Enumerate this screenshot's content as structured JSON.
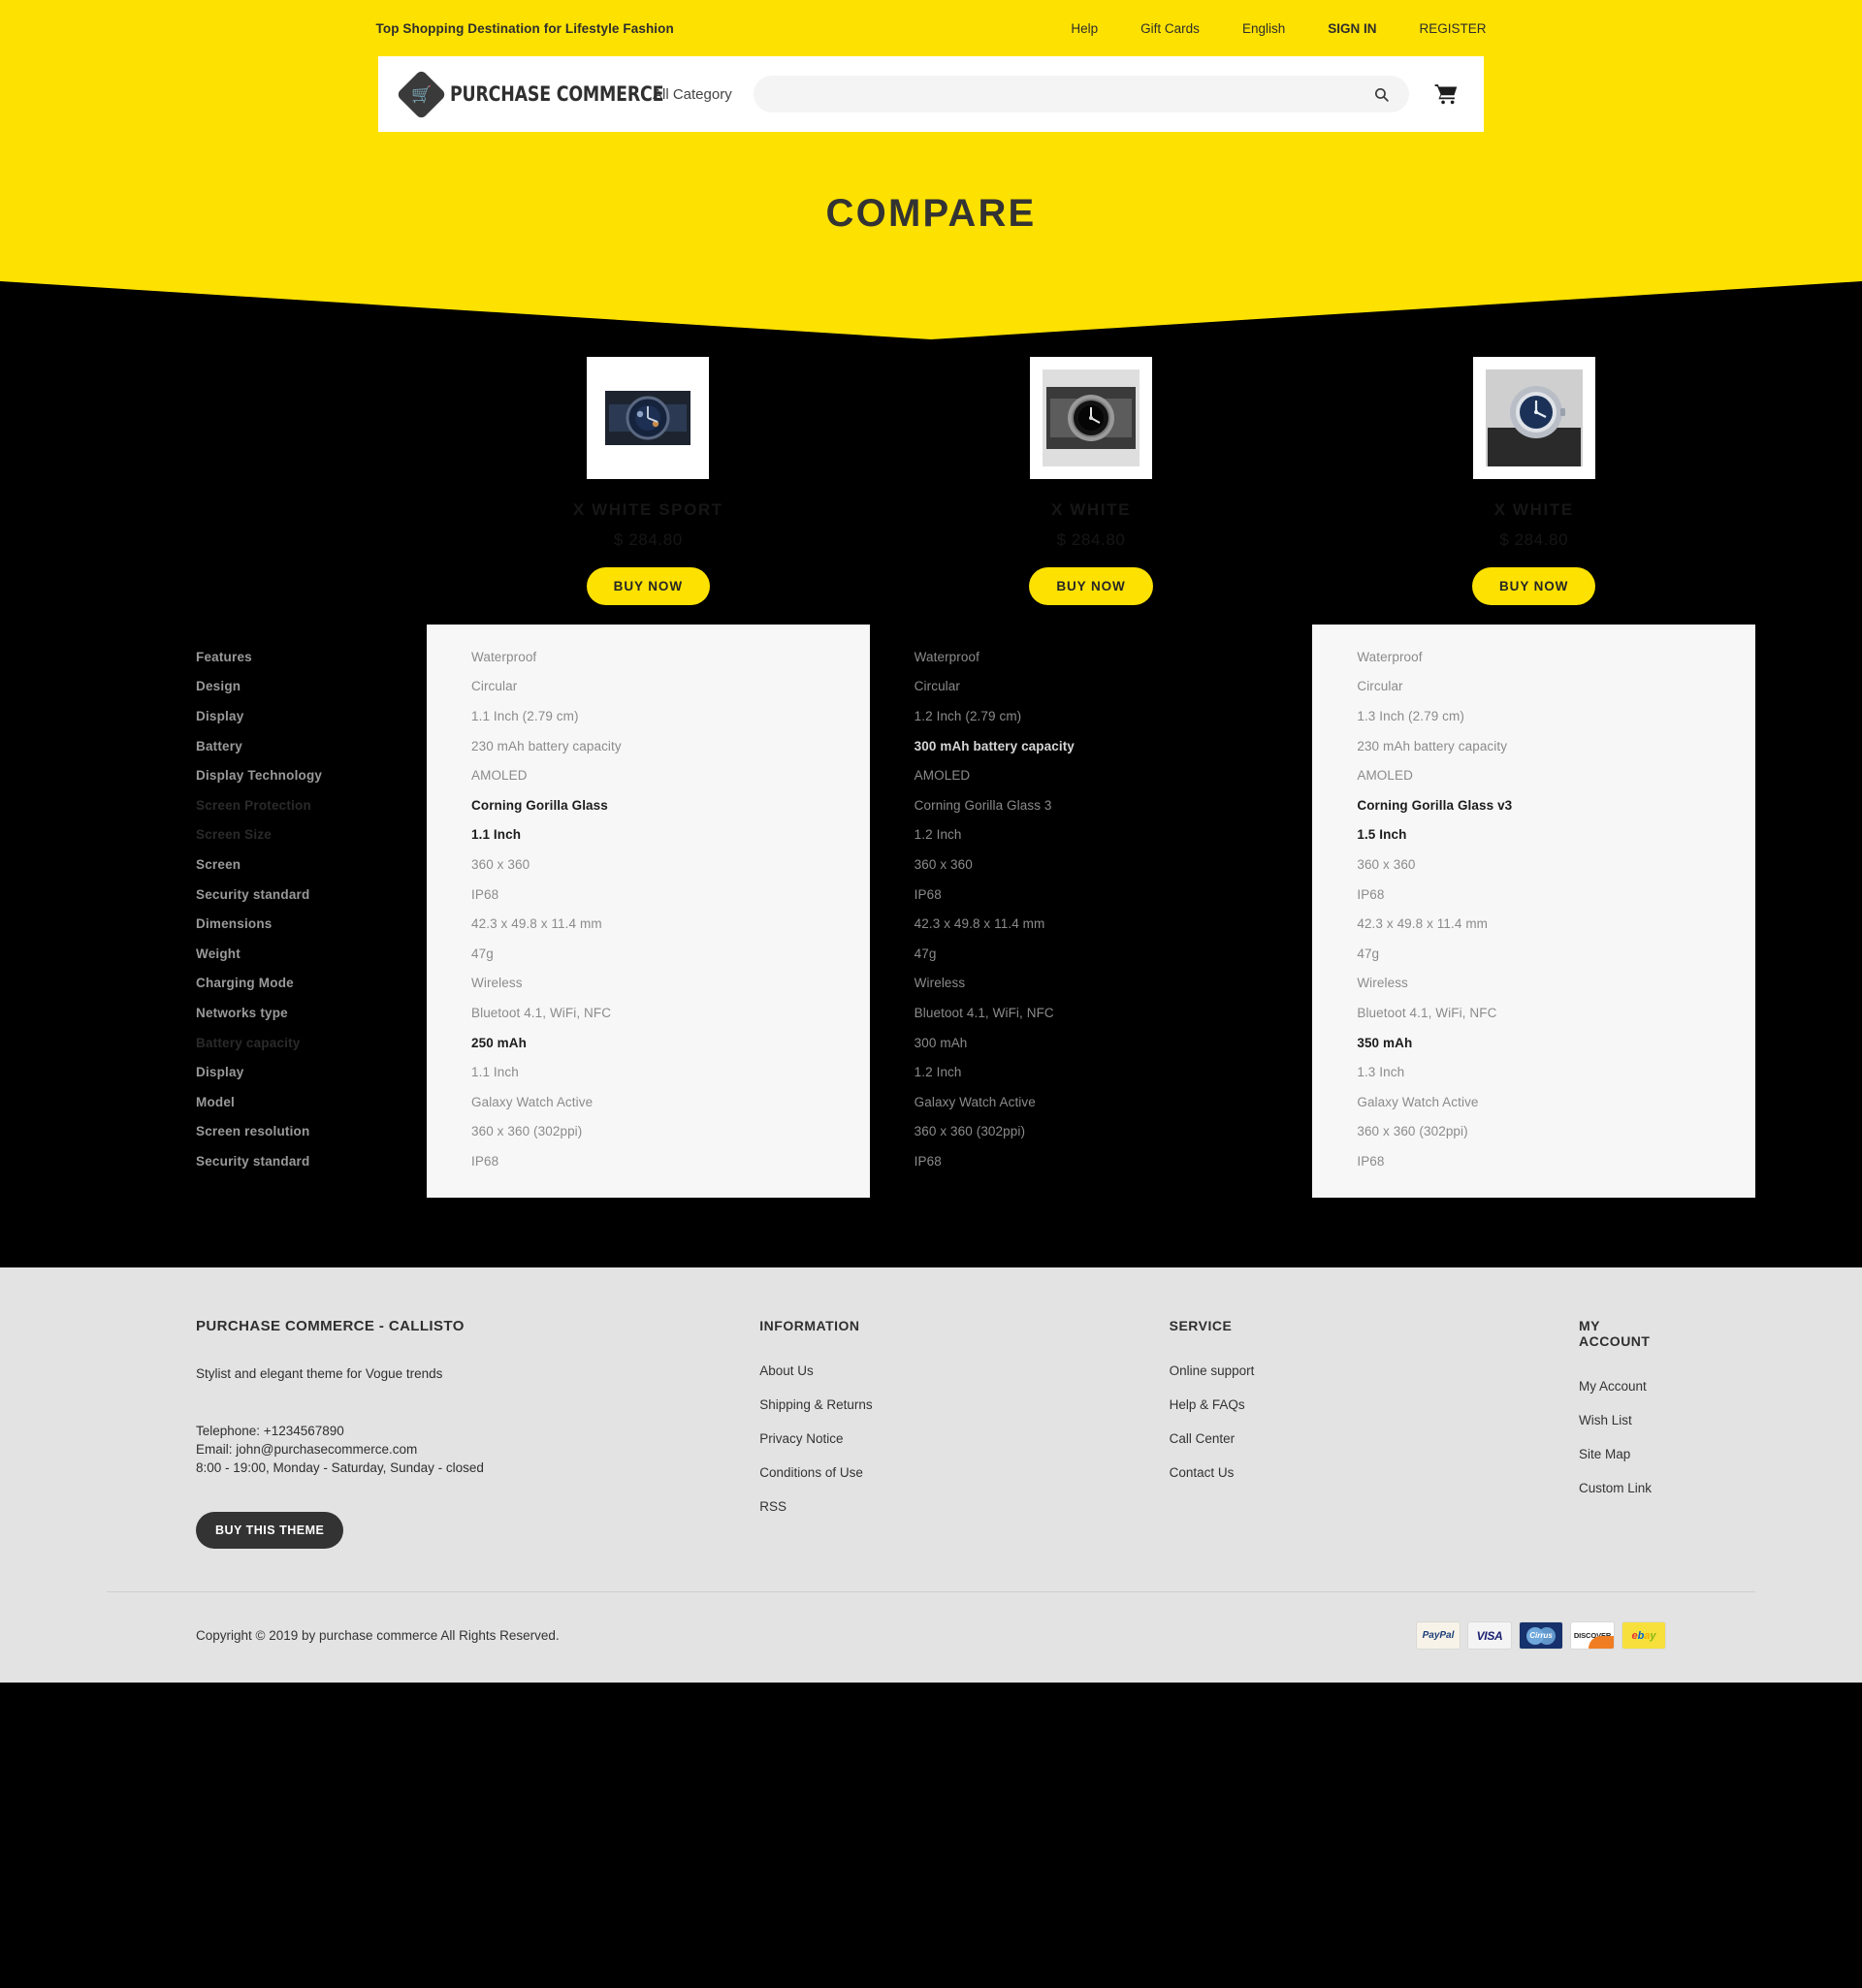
{
  "topbar": {
    "tagline": "Top Shopping Destination for Lifestyle Fashion",
    "links": [
      {
        "label": "Help",
        "bold": false
      },
      {
        "label": "Gift Cards",
        "bold": false
      },
      {
        "label": "English",
        "bold": false
      },
      {
        "label": "SIGN IN",
        "bold": true
      },
      {
        "label": "REGISTER",
        "bold": false
      }
    ]
  },
  "header": {
    "logo_text": "PURCHASE COMMERCE",
    "logo_icon": "shopping-cart-icon",
    "category_label": "All Category",
    "search_value": "",
    "search_placeholder": "",
    "search_icon": "search-icon",
    "cart_icon": "cart-icon"
  },
  "page": {
    "title": "COMPARE",
    "accent_color": "#FDE100",
    "background_color": "#000000"
  },
  "products": [
    {
      "name": "X WHITE SPORT",
      "price": "$ 284.80",
      "buy_label": "BUY NOW",
      "image_alt": "blue-chronograph-watch",
      "card_style": "light"
    },
    {
      "name": "X WHITE",
      "price": "$ 284.80",
      "buy_label": "BUY NOW",
      "image_alt": "black-dive-watch",
      "card_style": "dark"
    },
    {
      "name": "X WHITE",
      "price": "$ 284.80",
      "buy_label": "BUY NOW",
      "image_alt": "silver-blue-dial-watch",
      "card_style": "light"
    }
  ],
  "spec_labels": [
    {
      "label": "Features",
      "dim": false
    },
    {
      "label": "Design",
      "dim": false
    },
    {
      "label": "Display",
      "dim": false
    },
    {
      "label": "Battery",
      "dim": false
    },
    {
      "label": "Display Technology",
      "dim": false
    },
    {
      "label": "Screen Protection",
      "dim": true
    },
    {
      "label": "Screen Size",
      "dim": true
    },
    {
      "label": "Screen",
      "dim": false
    },
    {
      "label": "Security standard",
      "dim": false
    },
    {
      "label": "Dimensions",
      "dim": false
    },
    {
      "label": "Weight",
      "dim": false
    },
    {
      "label": "Charging Mode",
      "dim": false
    },
    {
      "label": "Networks type",
      "dim": false
    },
    {
      "label": "Battery capacity",
      "dim": true
    },
    {
      "label": "Display",
      "dim": false
    },
    {
      "label": "Model",
      "dim": false
    },
    {
      "label": "Screen resolution",
      "dim": false
    },
    {
      "label": "Security standard",
      "dim": false
    }
  ],
  "spec_columns": [
    {
      "values": [
        {
          "text": "Waterproof",
          "hl": false
        },
        {
          "text": "Circular",
          "hl": false
        },
        {
          "text": "1.1 Inch (2.79 cm)",
          "hl": false
        },
        {
          "text": "230 mAh battery capacity",
          "hl": false
        },
        {
          "text": "AMOLED",
          "hl": false
        },
        {
          "text": "Corning Gorilla Glass",
          "hl": true
        },
        {
          "text": "1.1 Inch",
          "hl": true
        },
        {
          "text": "360 x 360",
          "hl": false
        },
        {
          "text": "IP68",
          "hl": false
        },
        {
          "text": "42.3 x 49.8 x 11.4 mm",
          "hl": false
        },
        {
          "text": "47g",
          "hl": false
        },
        {
          "text": "Wireless",
          "hl": false
        },
        {
          "text": "Bluetoot 4.1, WiFi, NFC",
          "hl": false
        },
        {
          "text": "250 mAh",
          "hl": true
        },
        {
          "text": "1.1 Inch",
          "hl": false
        },
        {
          "text": "Galaxy Watch Active",
          "hl": false
        },
        {
          "text": "360 x 360 (302ppi)",
          "hl": false
        },
        {
          "text": "IP68",
          "hl": false
        }
      ]
    },
    {
      "values": [
        {
          "text": "Waterproof",
          "hl": false
        },
        {
          "text": "Circular",
          "hl": false
        },
        {
          "text": "1.2 Inch (2.79 cm)",
          "hl": false
        },
        {
          "text": "300 mAh battery capacity",
          "hl": true
        },
        {
          "text": "AMOLED",
          "hl": false
        },
        {
          "text": "Corning Gorilla Glass 3",
          "hl": false
        },
        {
          "text": "1.2 Inch",
          "hl": false
        },
        {
          "text": "360 x 360",
          "hl": false
        },
        {
          "text": "IP68",
          "hl": false
        },
        {
          "text": "42.3 x 49.8 x 11.4 mm",
          "hl": false
        },
        {
          "text": "47g",
          "hl": false
        },
        {
          "text": "Wireless",
          "hl": false
        },
        {
          "text": "Bluetoot 4.1, WiFi, NFC",
          "hl": false
        },
        {
          "text": "300 mAh",
          "hl": false
        },
        {
          "text": "1.2 Inch",
          "hl": false
        },
        {
          "text": "Galaxy Watch Active",
          "hl": false
        },
        {
          "text": "360 x 360 (302ppi)",
          "hl": false
        },
        {
          "text": "IP68",
          "hl": false
        }
      ]
    },
    {
      "values": [
        {
          "text": "Waterproof",
          "hl": false
        },
        {
          "text": "Circular",
          "hl": false
        },
        {
          "text": "1.3 Inch (2.79 cm)",
          "hl": false
        },
        {
          "text": "230 mAh battery capacity",
          "hl": false
        },
        {
          "text": "AMOLED",
          "hl": false
        },
        {
          "text": "Corning Gorilla Glass v3",
          "hl": true
        },
        {
          "text": "1.5 Inch",
          "hl": true
        },
        {
          "text": "360 x 360",
          "hl": false
        },
        {
          "text": "IP68",
          "hl": false
        },
        {
          "text": "42.3 x 49.8 x 11.4 mm",
          "hl": false
        },
        {
          "text": "47g",
          "hl": false
        },
        {
          "text": "Wireless",
          "hl": false
        },
        {
          "text": "Bluetoot 4.1, WiFi, NFC",
          "hl": false
        },
        {
          "text": "350 mAh",
          "hl": true
        },
        {
          "text": "1.3 Inch",
          "hl": false
        },
        {
          "text": "Galaxy Watch Active",
          "hl": false
        },
        {
          "text": "360 x 360 (302ppi)",
          "hl": false
        },
        {
          "text": "IP68",
          "hl": false
        }
      ]
    }
  ],
  "footer": {
    "brand_title": "PURCHASE COMMERCE - CALLISTO",
    "brand_sub": "Stylist and elegant theme for Vogue trends",
    "telephone": "Telephone: +1234567890",
    "email": "Email: john@purchasecommerce.com",
    "hours": "8:00 - 19:00, Monday - Saturday, Sunday - closed",
    "theme_button": "BUY THIS THEME",
    "information": {
      "title": "INFORMATION",
      "items": [
        "About Us",
        "Shipping & Returns",
        "Privacy Notice",
        "Conditions of Use",
        "RSS"
      ]
    },
    "service": {
      "title": "SERVICE",
      "items": [
        "Online support",
        "Help & FAQs",
        "Call Center",
        "Contact Us"
      ]
    },
    "account": {
      "title": "MY ACCOUNT",
      "items": [
        "My Account",
        "Wish List",
        "Site Map",
        "Custom Link"
      ]
    },
    "copyright": "Copyright © 2019 by purchase commerce All Rights Reserved.",
    "payments": [
      "PayPal",
      "VISA",
      "Cirrus",
      "DISCOVER",
      "ebay"
    ]
  }
}
